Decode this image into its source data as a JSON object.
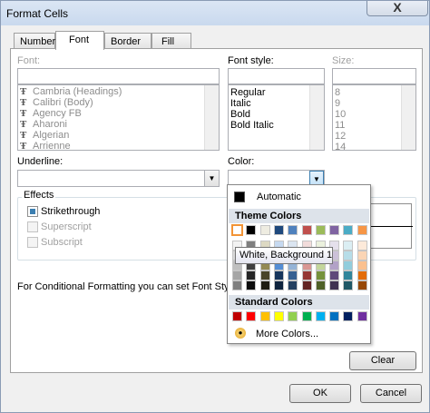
{
  "window": {
    "title": "Format Cells",
    "close_glyph": "X"
  },
  "tabs": [
    {
      "label": "Number"
    },
    {
      "label": "Font"
    },
    {
      "label": "Border"
    },
    {
      "label": "Fill"
    }
  ],
  "font": {
    "font_label": "Font:",
    "font_input": "",
    "fonts": [
      "Cambria (Headings)",
      "Calibri (Body)",
      "Agency FB",
      "Aharoni",
      "Algerian",
      "Arrienne"
    ],
    "style_label": "Font style:",
    "style_input": "",
    "styles": [
      "Regular",
      "Italic",
      "Bold",
      "Bold Italic"
    ],
    "size_label": "Size:",
    "size_input": "",
    "sizes": [
      "8",
      "9",
      "10",
      "11",
      "12",
      "14"
    ],
    "underline_label": "Underline:",
    "underline_value": "",
    "color_label": "Color:",
    "effects_label": "Effects",
    "strikethrough": "Strikethrough",
    "superscript": "Superscript",
    "subscript": "Subscript",
    "info_text": "For Conditional Formatting you can set Font Style, Ur"
  },
  "color_menu": {
    "automatic": "Automatic",
    "theme_header": "Theme Colors",
    "standard_header": "Standard Colors",
    "more_colors": "More Colors...",
    "tooltip": "White, Background 1",
    "theme_top": [
      "#ffffff",
      "#000000",
      "#eeece1",
      "#1f497d",
      "#4f81bd",
      "#c0504d",
      "#9bbb59",
      "#8064a2",
      "#4bacc6",
      "#f79646"
    ],
    "theme_shades": [
      [
        "#f2f2f2",
        "#7f7f7f",
        "#ddd9c3",
        "#c6d9f0",
        "#dbe5f1",
        "#f2dcdb",
        "#ebf1dd",
        "#e5e0ec",
        "#dbeef3",
        "#fdeada"
      ],
      [
        "#d8d8d8",
        "#595959",
        "#c4bd97",
        "#8db3e2",
        "#b8cce4",
        "#e5b9b7",
        "#d7e3bc",
        "#ccc1d9",
        "#b7dde8",
        "#fbd5b5"
      ],
      [
        "#bfbfbf",
        "#3f3f3f",
        "#938953",
        "#548dd4",
        "#95b3d7",
        "#d99694",
        "#c3d69b",
        "#b2a2c7",
        "#92cddc",
        "#fac08f"
      ],
      [
        "#a5a5a5",
        "#262626",
        "#494429",
        "#17365d",
        "#366092",
        "#953734",
        "#76923c",
        "#5f497a",
        "#31859b",
        "#e36c09"
      ],
      [
        "#7f7f7f",
        "#0c0c0c",
        "#1d1b10",
        "#0f243e",
        "#244061",
        "#632423",
        "#4f6128",
        "#3f3151",
        "#205867",
        "#974806"
      ]
    ],
    "standard": [
      "#c00000",
      "#ff0000",
      "#ffc000",
      "#ffff00",
      "#92d050",
      "#00b050",
      "#00b0f0",
      "#0070c0",
      "#002060",
      "#7030a0"
    ]
  },
  "buttons": {
    "clear": "Clear",
    "ok": "OK",
    "cancel": "Cancel"
  }
}
